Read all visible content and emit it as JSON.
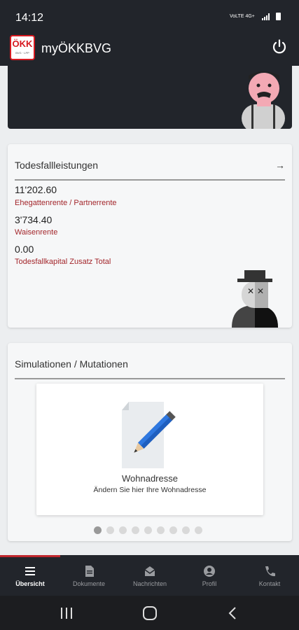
{
  "status": {
    "time": "14:12",
    "network": "VoLTE 4G+"
  },
  "app": {
    "title": "myÖKKBVG",
    "logo_text": "ÖKK",
    "logo_sub": "BVG · LPP"
  },
  "todesfall": {
    "heading": "Todesfallleistungen",
    "items": [
      {
        "amount": "11'202.60",
        "label": "Ehegattenrente / Partnerrente"
      },
      {
        "amount": "3'734.40",
        "label": "Waisenrente"
      },
      {
        "amount": "0.00",
        "label": "Todesfallkapital Zusatz Total"
      }
    ]
  },
  "simulationen": {
    "heading": "Simulationen / Mutationen",
    "slide": {
      "title": "Wohnadresse",
      "subtitle": "Ändern Sie hier Ihre Wohnadresse"
    },
    "dots_count": 9,
    "active_dot": 0
  },
  "nav": [
    {
      "label": "Übersicht",
      "icon": "menu-icon",
      "active": true
    },
    {
      "label": "Dokumente",
      "icon": "document-icon",
      "active": false
    },
    {
      "label": "Nachrichten",
      "icon": "mail-icon",
      "active": false
    },
    {
      "label": "Profil",
      "icon": "user-icon",
      "active": false
    },
    {
      "label": "Kontakt",
      "icon": "phone-icon",
      "active": false
    }
  ],
  "colors": {
    "dark": "#22252b",
    "accent_red": "#c0272d",
    "label_red": "#a3262b"
  }
}
